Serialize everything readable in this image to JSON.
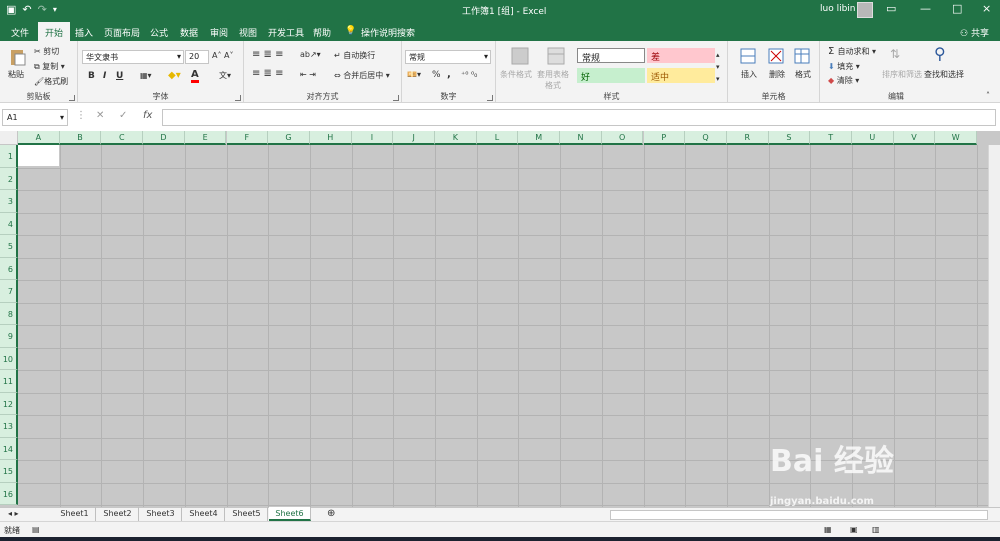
{
  "titlebar": {
    "title": "工作簿1  [组]  -  Excel",
    "user": "luo libin",
    "buttons": [
      "—",
      "□",
      "×"
    ]
  },
  "tabs": [
    "文件",
    "开始",
    "插入",
    "页面布局",
    "公式",
    "数据",
    "审阅",
    "视图",
    "开发工具",
    "帮助"
  ],
  "search_tab": "操作说明搜索",
  "share": "共享",
  "ribbon": {
    "clipboard": {
      "label": "剪贴板",
      "paste": "粘贴",
      "cut": "剪切",
      "copy": "复制",
      "format_painter": "格式刷"
    },
    "font": {
      "label": "字体",
      "name": "华文隶书",
      "size": "20",
      "bold": "B",
      "italic": "I",
      "underline": "U"
    },
    "alignment": {
      "label": "对齐方式",
      "wrap": "自动换行",
      "merge": "合并后居中"
    },
    "number": {
      "label": "数字",
      "format": "常规",
      "percent": "%",
      "comma": ","
    },
    "styles": {
      "label": "样式",
      "cond": "条件格式",
      "table": "套用表格格式",
      "normal": "常规",
      "bad": "差",
      "good": "好",
      "neutral": "适中"
    },
    "cells": {
      "label": "单元格",
      "insert": "插入",
      "delete": "删除",
      "format": "格式"
    },
    "editing": {
      "label": "编辑",
      "autosum": "自动求和",
      "fill": "填充",
      "clear": "清除",
      "sort": "排序和筛选",
      "find": "查找和选择"
    }
  },
  "formula_bar": {
    "namebox": "A1",
    "fx": "fx"
  },
  "columns": [
    "A",
    "B",
    "C",
    "D",
    "E",
    "F",
    "G",
    "H",
    "I",
    "J",
    "K",
    "L",
    "M",
    "N",
    "O",
    "P",
    "Q",
    "R",
    "S",
    "T",
    "U",
    "V",
    "W"
  ],
  "rows": [
    "1",
    "2",
    "3",
    "4",
    "5",
    "6",
    "7",
    "8",
    "9",
    "10",
    "11",
    "12",
    "13",
    "14",
    "15",
    "16"
  ],
  "sheets": [
    "Sheet1",
    "Sheet2",
    "Sheet3",
    "Sheet4",
    "Sheet5",
    "Sheet6"
  ],
  "status": {
    "ready": "就绪"
  },
  "watermark": {
    "big": "Bai  经验",
    "small": "jingyan.baidu.com"
  },
  "colors": {
    "accent": "#217346",
    "bad_bg": "#ffc7ce",
    "bad_fg": "#9c0006",
    "good_bg": "#c6efce",
    "good_fg": "#006100",
    "neutral_bg": "#ffeb9c",
    "neutral_fg": "#9c5700"
  }
}
